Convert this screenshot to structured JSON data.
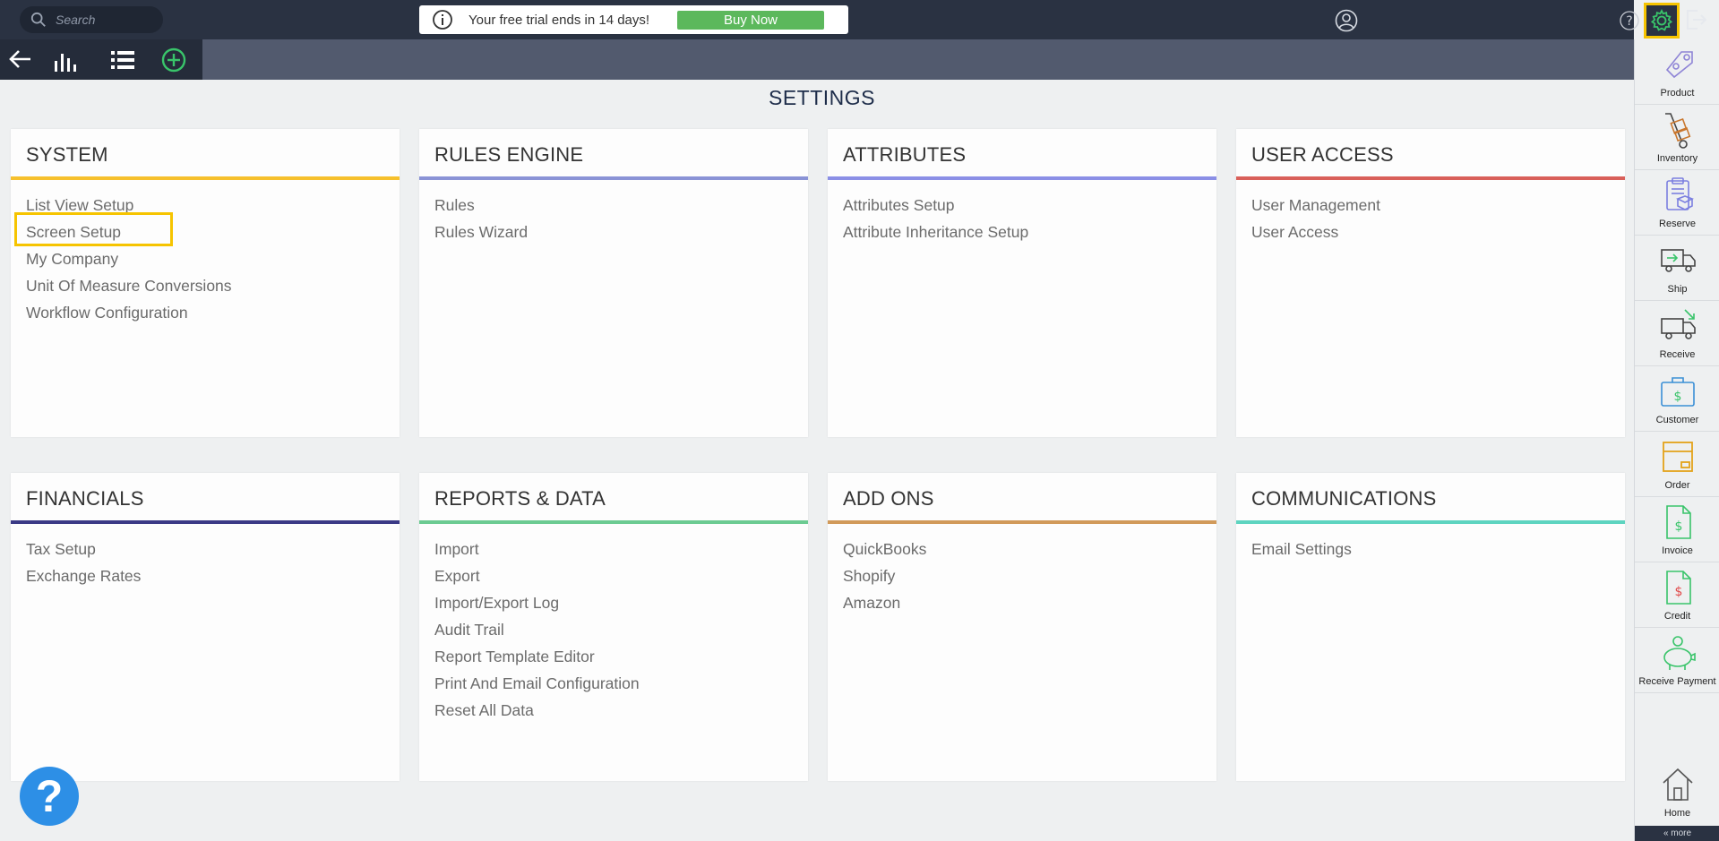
{
  "topbar": {
    "search_placeholder": "Search",
    "trial_text": "Your free trial ends in 14 days!",
    "buy_label": "Buy Now"
  },
  "page": {
    "title": "SETTINGS"
  },
  "sections": [
    {
      "title": "SYSTEM",
      "color": "#f6c02c",
      "items": [
        "List View Setup",
        "Screen Setup",
        "My Company",
        "Unit Of Measure Conversions",
        "Workflow Configuration"
      ]
    },
    {
      "title": "RULES ENGINE",
      "color": "#8a93d6",
      "items": [
        "Rules",
        "Rules Wizard"
      ]
    },
    {
      "title": "ATTRIBUTES",
      "color": "#8b8fe6",
      "items": [
        "Attributes Setup",
        "Attribute Inheritance Setup"
      ]
    },
    {
      "title": "USER ACCESS",
      "color": "#d9605a",
      "items": [
        "User Management",
        "User Access"
      ]
    },
    {
      "title": "FINANCIALS",
      "color": "#3b3a86",
      "items": [
        "Tax Setup",
        "Exchange Rates"
      ]
    },
    {
      "title": "REPORTS & DATA",
      "color": "#6ccb92",
      "items": [
        "Import",
        "Export",
        "Import/Export Log",
        "Audit Trail",
        "Report Template Editor",
        "Print And Email Configuration",
        "Reset All Data"
      ]
    },
    {
      "title": "ADD ONS",
      "color": "#d19a5a",
      "items": [
        "QuickBooks",
        "Shopify",
        "Amazon"
      ]
    },
    {
      "title": "COMMUNICATIONS",
      "color": "#5ed4c0",
      "items": [
        "Email Settings"
      ]
    }
  ],
  "sidebar": {
    "items": [
      {
        "label": "Product",
        "icon": "product-tag-icon"
      },
      {
        "label": "Inventory",
        "icon": "hand-truck-icon"
      },
      {
        "label": "Reserve",
        "icon": "clipboard-box-icon"
      },
      {
        "label": "Ship",
        "icon": "truck-out-icon"
      },
      {
        "label": "Receive",
        "icon": "truck-in-icon"
      },
      {
        "label": "Customer",
        "icon": "briefcase-dollar-icon"
      },
      {
        "label": "Order",
        "icon": "box-icon"
      },
      {
        "label": "Invoice",
        "icon": "invoice-icon"
      },
      {
        "label": "Credit",
        "icon": "credit-icon"
      },
      {
        "label": "Receive Payment",
        "icon": "piggy-bank-icon"
      }
    ],
    "home_label": "Home",
    "more_label": "« more"
  },
  "help": {
    "label": "?"
  }
}
